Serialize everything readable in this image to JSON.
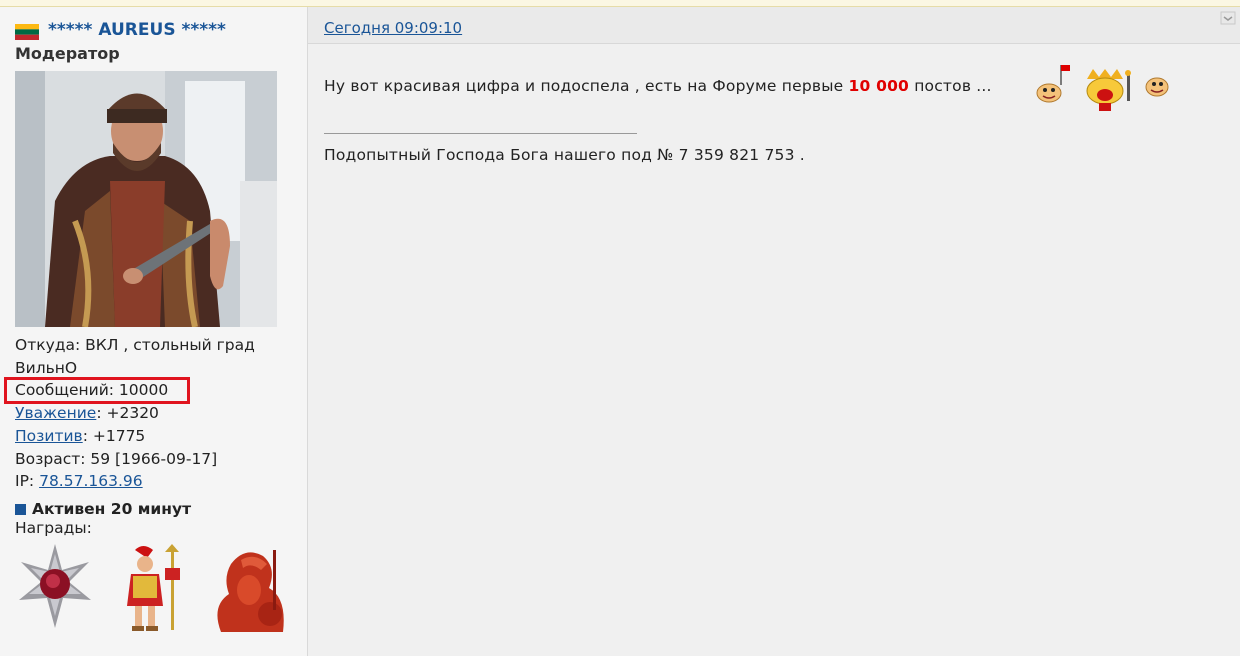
{
  "user": {
    "nickname": "***** AUREUS *****",
    "role": "Модератор",
    "from_label": "Откуда:",
    "from_line1": "ВКЛ , стольный град",
    "from_line2": "ВильнО",
    "messages": "Сообщений: 10000",
    "respect_label": "Уважение",
    "respect_value": ": +2320",
    "positive_label": "Позитив",
    "positive_value": ": +1775",
    "age": "Возраст: 59 [1966-09-17]",
    "ip_label": "IP:",
    "ip_value": "78.57.163.96",
    "status": "Активен 20 минут",
    "awards_label": "Награды:"
  },
  "post": {
    "date": "Сегодня 09:09:10",
    "text_before": "Ну вот красивая цифра и подоспела , есть на Форуме первые",
    "text_highlight": "10 000",
    "text_after": "постов ...",
    "signature": "Подопытный Господа Бога нашего под № 7 359 821 753 ."
  },
  "colors": {
    "link": "#1a5597",
    "highlight_text": "#e00000",
    "annotation_box": "#e0141e"
  },
  "icons": [
    "lithuania-flag-icon",
    "fold-icon",
    "smiley-flag-icon",
    "smiley-crowd-icon",
    "smiley-icon",
    "star-order-award-icon",
    "roman-soldier-award-icon",
    "bust-award-icon"
  ]
}
